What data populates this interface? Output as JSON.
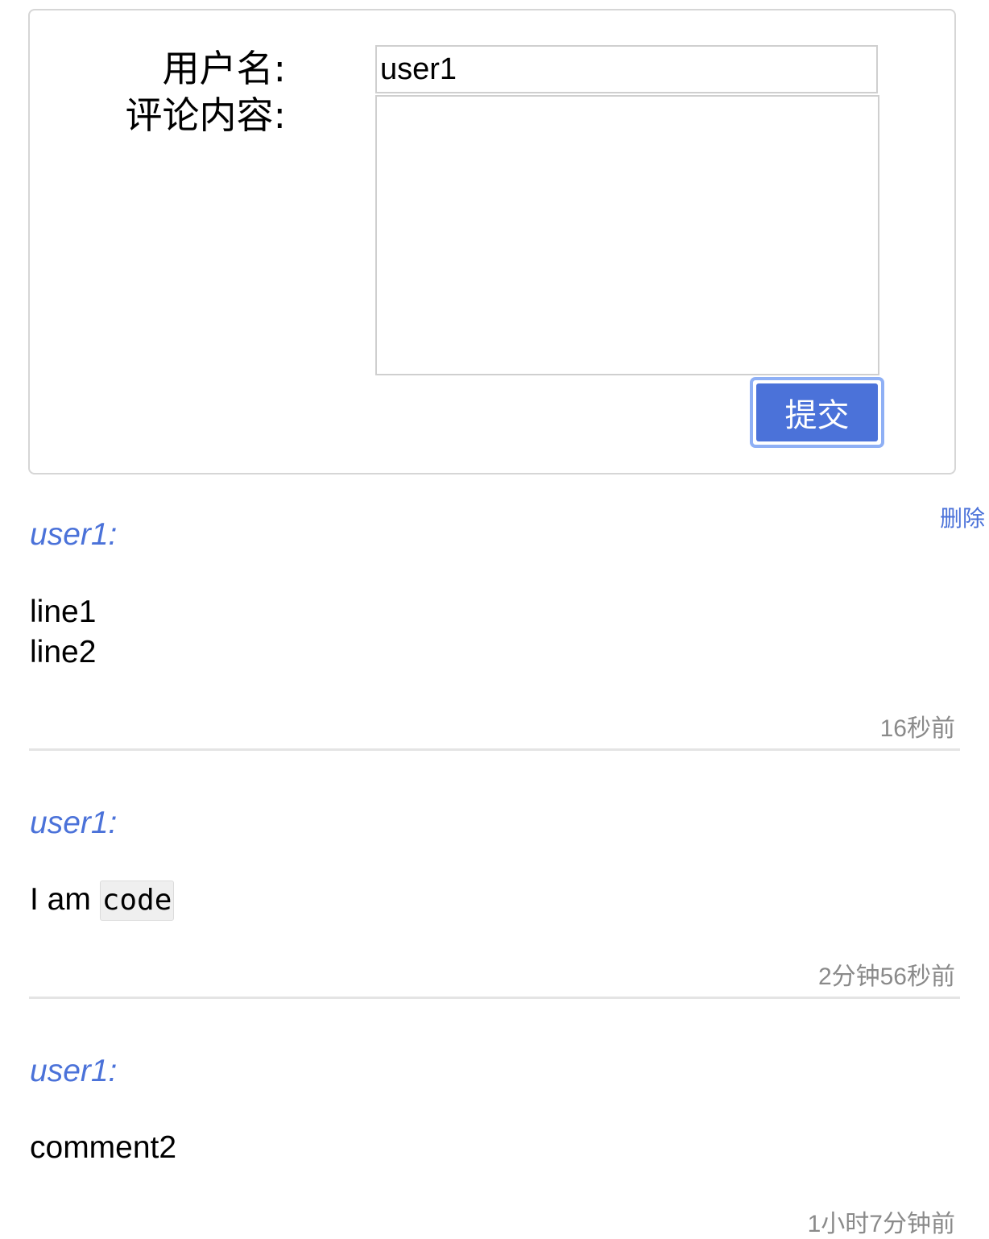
{
  "form": {
    "username_label": "用户名:",
    "content_label": "评论内容:",
    "username_value": "user1",
    "content_value": "",
    "submit_label": "提交"
  },
  "comments": [
    {
      "author": "user1:",
      "body_lines": [
        "line1",
        "line2"
      ],
      "time": "16秒前",
      "delete_label": "删除"
    },
    {
      "author": "user1:",
      "body_text": "I am ",
      "body_code": "code",
      "time": "2分钟56秒前"
    },
    {
      "author": "user1:",
      "body_text": "comment2",
      "time": "1小时7分钟前"
    }
  ],
  "colors": {
    "accent": "#4b72d9",
    "muted": "#8a8a8a",
    "border": "#d6d6d6"
  }
}
